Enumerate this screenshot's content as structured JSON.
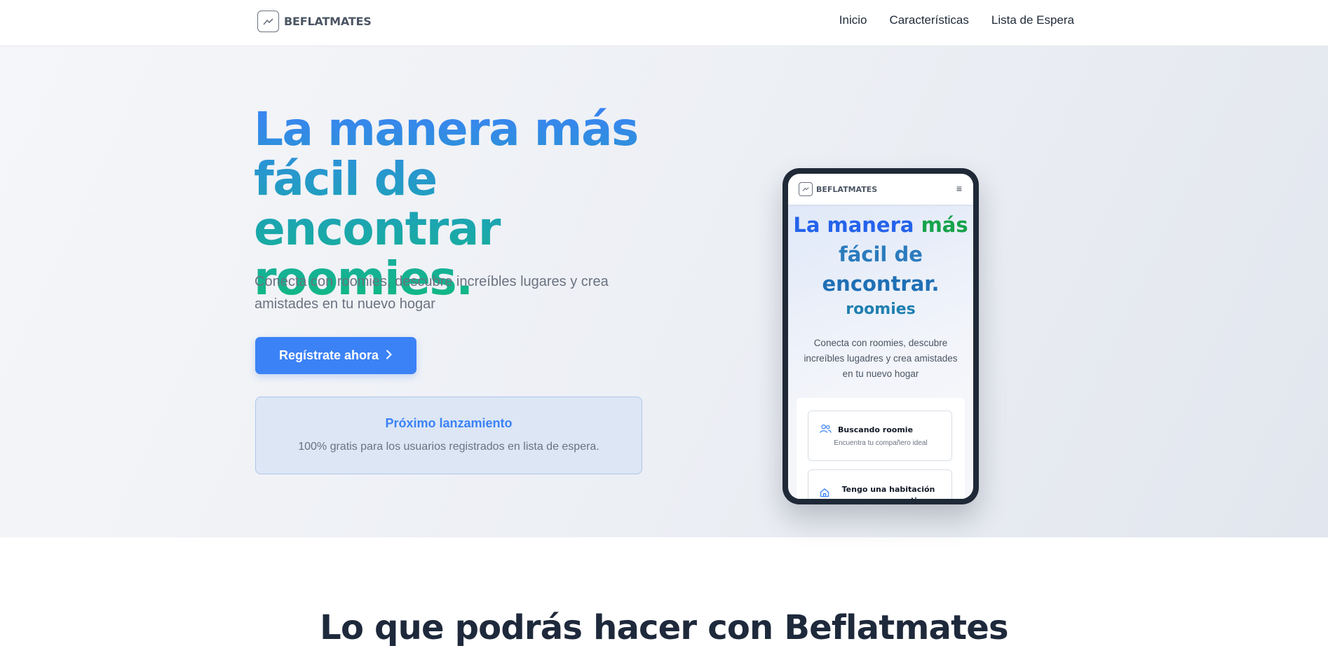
{
  "nav": {
    "brand": "BEFLATMATES",
    "links": [
      "Inicio",
      "Características",
      "Lista de Espera"
    ]
  },
  "hero": {
    "title": "La manera más fácil de encontrar roomies.",
    "subtitle": "Conecta con roomies, descubre increíbles lugares y crea amistades en tu nuevo hogar",
    "cta_label": "Regístrate ahora",
    "launch": {
      "title": "Próximo lanzamiento",
      "text": "100% gratis para los usuarios registrados en lista de espera."
    }
  },
  "phone": {
    "brand": "BEFLATMATES",
    "menu_icon": "≡",
    "title_line1_a": "La manera",
    "title_line1_b": "más",
    "title_line2": "fácil de",
    "title_line3": "encontrar.",
    "roomies": "roomies",
    "subtitle": "Conecta con roomies, descubre increíbles lugadres y crea amistades en tu nuevo hogar",
    "options": [
      {
        "title": "Buscando roomie",
        "subtitle": "Encuentra tu compañero ideal",
        "icon": "users-icon"
      },
      {
        "title": "Tengo una habitación para compartir",
        "icon": "home-icon"
      }
    ]
  },
  "features": {
    "title": "Lo que podrás hacer con Beflatmates"
  },
  "colors": {
    "accent": "#3b82f6",
    "gradient_start": "#3b82f6",
    "gradient_end": "#10b981",
    "heading": "#1e293b"
  }
}
